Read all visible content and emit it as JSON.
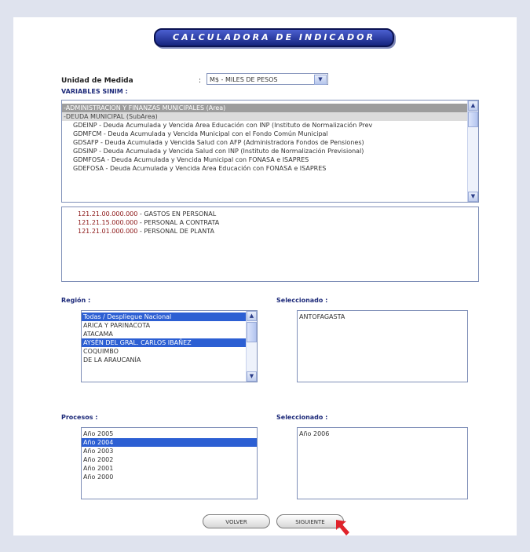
{
  "header": {
    "title": "CALCULADORA DE INDICADOR"
  },
  "unidad": {
    "label": "Unidad de Medida",
    "colon": ":",
    "value": "M$ - MILES DE PESOS"
  },
  "variables": {
    "label": "VARIABLES SINIM :",
    "items": [
      {
        "text": "-ADMINISTRACION Y FINANZAS MUNICIPALES (Area)",
        "kind": "area"
      },
      {
        "text": "-DEUDA MUNICIPAL (SubArea)",
        "kind": "subarea"
      },
      {
        "text": "GDEINP - Deuda Acumulada y Vencida Area Educación con INP (Instituto de Normalización Prev",
        "kind": "item"
      },
      {
        "text": "GDMFCM - Deuda Acumulada y Vencida Municipal con el Fondo Común Municipal",
        "kind": "item"
      },
      {
        "text": "GDSAFP - Deuda Acumulada y Vencida Salud con AFP (Administradora Fondos de Pensiones)",
        "kind": "item"
      },
      {
        "text": "GDSINP - Deuda Acumulada y Vencida Salud con INP (Instituto de Normalización Previsional)",
        "kind": "item"
      },
      {
        "text": "GDMFOSA - Deuda Acumulada y Vencida Municipal con FONASA e ISAPRES",
        "kind": "item"
      },
      {
        "text": "GDEFOSA - Deuda Acumulada y Vencida Area Educación con FONASA e ISAPRES",
        "kind": "item"
      }
    ]
  },
  "codes": [
    {
      "code": "121.21.00.000.000",
      "desc": " - GASTOS EN PERSONAL"
    },
    {
      "code": "121.21.15.000.000",
      "desc": " - PERSONAL A CONTRATA"
    },
    {
      "code": "121.21.01.000.000",
      "desc": " - PERSONAL DE PLANTA"
    }
  ],
  "region": {
    "label": "Región :",
    "options": [
      {
        "text": "Todas / Despliegue Nacional",
        "selected": true
      },
      {
        "text": "ARICA Y PARINACOTA",
        "selected": false
      },
      {
        "text": "ATACAMA",
        "selected": false
      },
      {
        "text": "AYSÉN DEL GRAL. CARLOS IBAÑEZ",
        "selected": true
      },
      {
        "text": "COQUIMBO",
        "selected": false
      },
      {
        "text": "DE LA ARAUCANÍA",
        "selected": false
      }
    ],
    "selected_label": "Seleccionado :",
    "selected_items": [
      "ANTOFAGASTA"
    ]
  },
  "procesos": {
    "label": "Procesos :",
    "options": [
      {
        "text": "Año 2005",
        "selected": false
      },
      {
        "text": "Año 2004",
        "selected": true
      },
      {
        "text": "Año 2003",
        "selected": false
      },
      {
        "text": "Año 2002",
        "selected": false
      },
      {
        "text": "Año 2001",
        "selected": false
      },
      {
        "text": "Año 2000",
        "selected": false
      }
    ],
    "selected_label": "Seleccionado :",
    "selected_items": [
      "Año 2006"
    ]
  },
  "buttons": {
    "back": "VOLVER",
    "next": "SIGUIENTE"
  },
  "colors": {
    "title_bg": "#1f2f95",
    "highlight": "#2c5fd3",
    "label_blue": "#1e2b7a",
    "cursor": "#e0232b"
  }
}
